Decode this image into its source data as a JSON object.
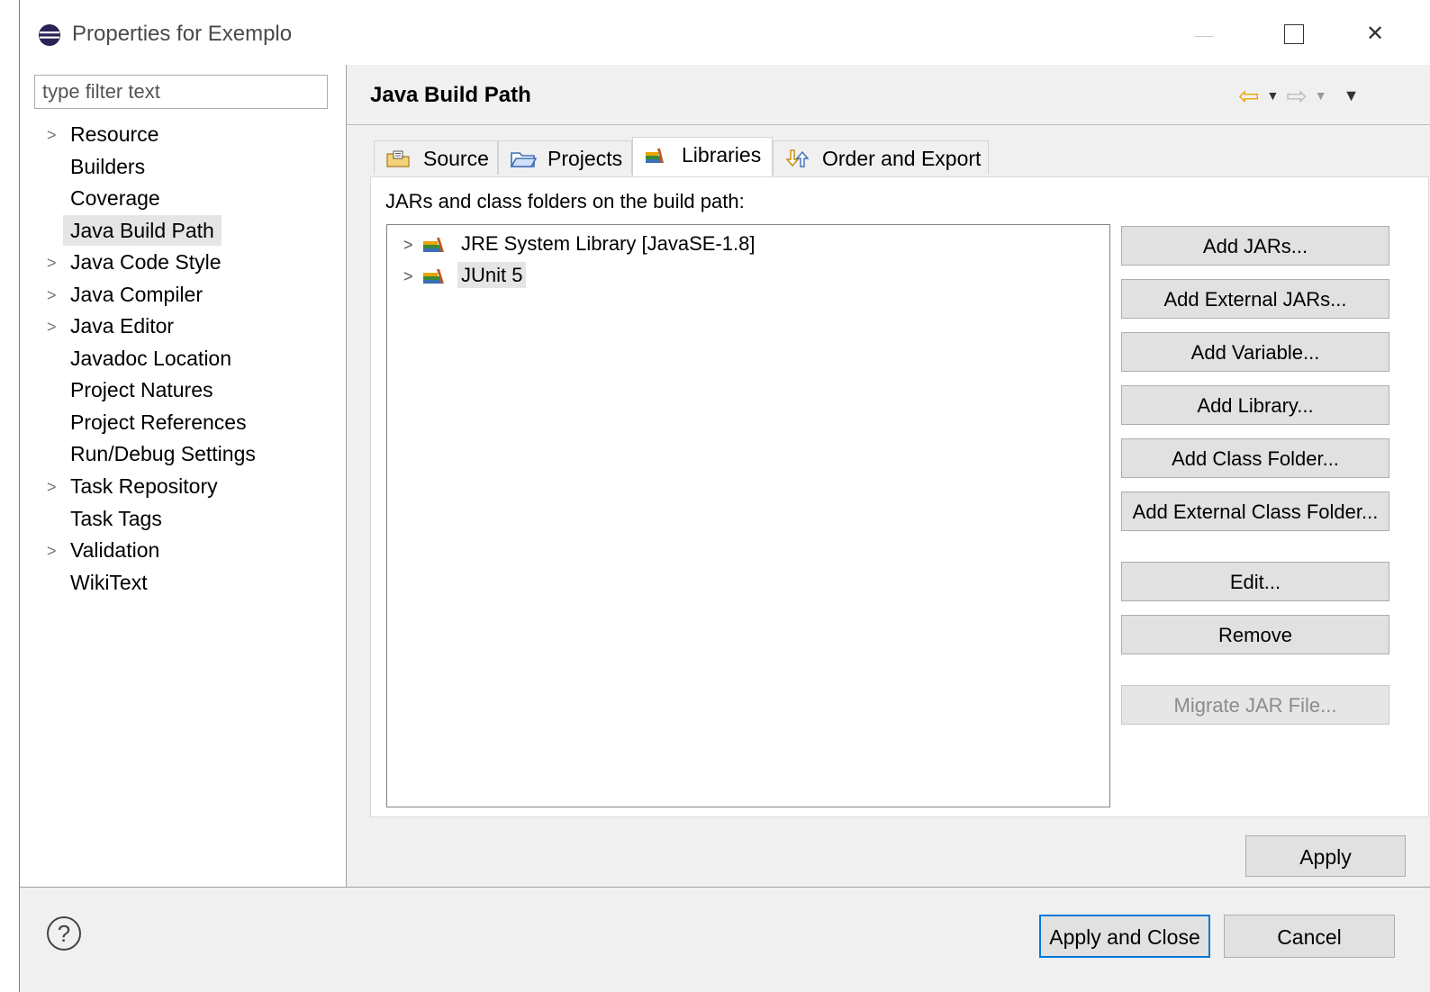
{
  "window": {
    "title": "Properties for Exemplo"
  },
  "left": {
    "filter_placeholder": "type filter text",
    "items": [
      {
        "label": "Resource",
        "expandable": true
      },
      {
        "label": "Builders",
        "expandable": false
      },
      {
        "label": "Coverage",
        "expandable": false
      },
      {
        "label": "Java Build Path",
        "expandable": false,
        "selected": true
      },
      {
        "label": "Java Code Style",
        "expandable": true
      },
      {
        "label": "Java Compiler",
        "expandable": true
      },
      {
        "label": "Java Editor",
        "expandable": true
      },
      {
        "label": "Javadoc Location",
        "expandable": false
      },
      {
        "label": "Project Natures",
        "expandable": false
      },
      {
        "label": "Project References",
        "expandable": false
      },
      {
        "label": "Run/Debug Settings",
        "expandable": false
      },
      {
        "label": "Task Repository",
        "expandable": true
      },
      {
        "label": "Task Tags",
        "expandable": false
      },
      {
        "label": "Validation",
        "expandable": true
      },
      {
        "label": "WikiText",
        "expandable": false
      }
    ]
  },
  "page": {
    "title": "Java Build Path",
    "tabs": [
      {
        "label": "Source",
        "icon": "source-folder-icon"
      },
      {
        "label": "Projects",
        "icon": "projects-folder-icon"
      },
      {
        "label": "Libraries",
        "icon": "libraries-icon",
        "active": true
      },
      {
        "label": "Order and Export",
        "icon": "order-export-icon"
      }
    ],
    "jars_label": "JARs and class folders on the build path:",
    "jars": [
      {
        "label": "JRE System Library [JavaSE-1.8]"
      },
      {
        "label": "JUnit 5",
        "selected": true
      }
    ],
    "buttons": {
      "add_jars": "Add JARs...",
      "add_external_jars": "Add External JARs...",
      "add_variable": "Add Variable...",
      "add_library": "Add Library...",
      "add_class_folder": "Add Class Folder...",
      "add_external_class_folder": "Add External Class Folder...",
      "edit": "Edit...",
      "remove": "Remove",
      "migrate_jar": "Migrate JAR File..."
    },
    "apply": "Apply"
  },
  "footer": {
    "help": "?",
    "apply_and_close": "Apply and Close",
    "cancel": "Cancel"
  },
  "colors": {
    "accent": "#0078d7",
    "nav_back": "#e8a400",
    "selection": "#e5e5e5"
  }
}
